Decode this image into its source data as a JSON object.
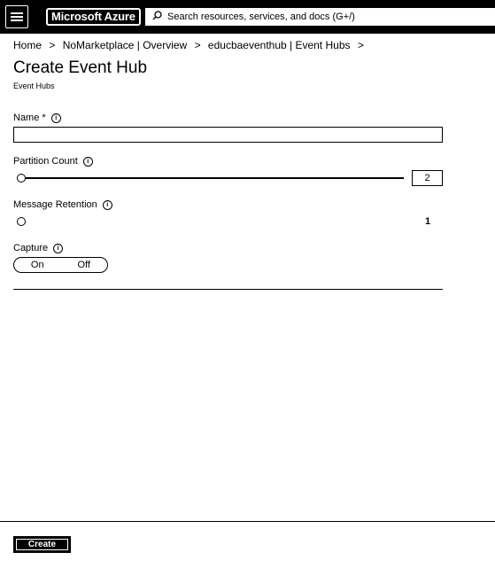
{
  "topbar": {
    "menu_icon": "hamburger-menu-icon",
    "brand": "Microsoft Azure",
    "search_icon": "search-icon",
    "search_placeholder": "Search resources, services, and docs (G+/)"
  },
  "breadcrumb": {
    "items": [
      "Home",
      "NoMarketplace | Overview",
      "educbaeventhub | Event Hubs"
    ],
    "separator": ">"
  },
  "page": {
    "title": "Create Event Hub",
    "subtitle": "Event Hubs"
  },
  "form": {
    "name": {
      "label": "Name *",
      "value": "",
      "info_icon": "info-icon"
    },
    "partition_count": {
      "label": "Partition Count",
      "value": "2",
      "slider_fraction": 0.0
    },
    "message_retention": {
      "label": "Message Retention",
      "value": "1",
      "slider_fraction": 0.0
    },
    "capture": {
      "label": "Capture",
      "options": [
        "On",
        "Off"
      ],
      "selected": "On"
    }
  },
  "footer": {
    "create_label": "Create"
  }
}
